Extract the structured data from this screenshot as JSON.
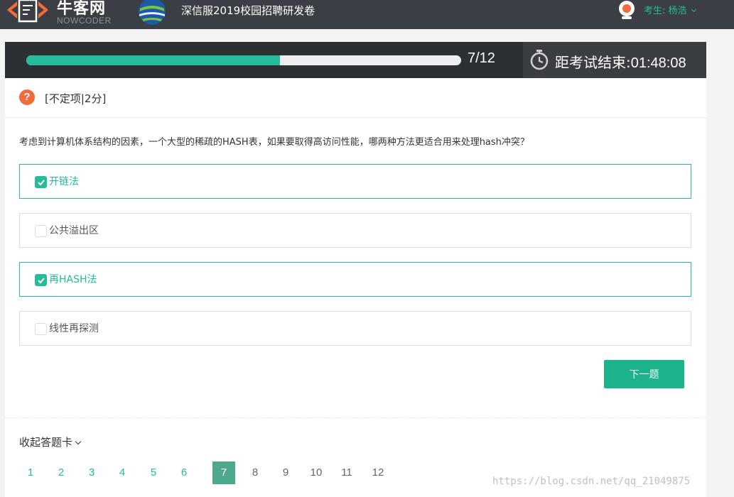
{
  "header": {
    "brand_cn": "牛客网",
    "brand_en": "NOWCODER",
    "exam_title": "深信服2019校园招聘研发卷",
    "user_label": "考生: 杨浩"
  },
  "progress": {
    "current": 7,
    "total": 12,
    "fraction": 0.583,
    "count_text": "7/12"
  },
  "timer": {
    "label": "距考试结束:",
    "value": "01:48:08"
  },
  "question": {
    "type": "[不定项|2分]",
    "text": "考虑到计算机体系结构的因素，一个大型的稀疏的HASH表，如果要取得高访问性能，哪两种方法更适合用来处理hash冲突？",
    "options": [
      {
        "label": "开链法",
        "checked": true
      },
      {
        "label": "公共溢出区",
        "checked": false
      },
      {
        "label": "再HASH法",
        "checked": true
      },
      {
        "label": "线性再探测",
        "checked": false
      }
    ]
  },
  "next_button": "下一题",
  "answer_card": {
    "toggle_label": "收起答题卡",
    "numbers": [
      "1",
      "2",
      "3",
      "4",
      "5",
      "6",
      "7",
      "8",
      "9",
      "10",
      "11",
      "12"
    ],
    "current_index": 6
  },
  "watermark": "https://blog.csdn.net/qq_21049875",
  "colors": {
    "accent": "#25bb9b",
    "topbar": "#3b3e45",
    "progress_bg": "#2c2f33",
    "question_icon": "#f36b3b"
  }
}
